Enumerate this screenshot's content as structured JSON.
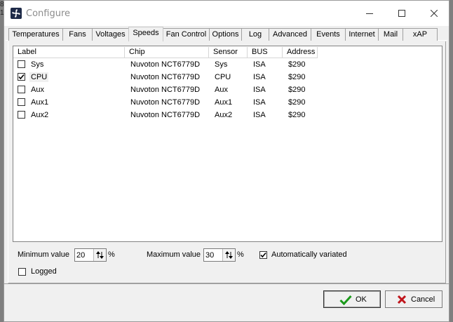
{
  "background_chars": [
    "8",
    "1"
  ],
  "window": {
    "title": "Configure",
    "icon": "fan-icon",
    "controls": [
      "minimize-icon",
      "maximize-icon",
      "close-icon"
    ]
  },
  "tabs": [
    {
      "label": "Temperatures",
      "active": false
    },
    {
      "label": "Fans",
      "active": false
    },
    {
      "label": "Voltages",
      "active": false
    },
    {
      "label": "Speeds",
      "active": true
    },
    {
      "label": "Fan Control",
      "active": false
    },
    {
      "label": "Options",
      "active": false
    },
    {
      "label": "Log",
      "active": false
    },
    {
      "label": "Advanced",
      "active": false
    },
    {
      "label": "Events",
      "active": false
    },
    {
      "label": "Internet",
      "active": false
    },
    {
      "label": "Mail",
      "active": false
    },
    {
      "label": "xAP",
      "active": false
    }
  ],
  "list": {
    "columns": [
      "Label",
      "Chip",
      "Sensor",
      "BUS",
      "Address"
    ],
    "rows": [
      {
        "checked": false,
        "label": "Sys",
        "chip": "Nuvoton NCT6779D",
        "sensor": "Sys",
        "bus": "ISA",
        "address": "$290"
      },
      {
        "checked": true,
        "label": "CPU",
        "chip": "Nuvoton NCT6779D",
        "sensor": "CPU",
        "bus": "ISA",
        "address": "$290"
      },
      {
        "checked": false,
        "label": "Aux",
        "chip": "Nuvoton NCT6779D",
        "sensor": "Aux",
        "bus": "ISA",
        "address": "$290"
      },
      {
        "checked": false,
        "label": "Aux1",
        "chip": "Nuvoton NCT6779D",
        "sensor": "Aux1",
        "bus": "ISA",
        "address": "$290"
      },
      {
        "checked": false,
        "label": "Aux2",
        "chip": "Nuvoton NCT6779D",
        "sensor": "Aux2",
        "bus": "ISA",
        "address": "$290"
      }
    ]
  },
  "settings": {
    "minimum_label": "Minimum value",
    "minimum_value": "20",
    "minimum_unit": "%",
    "maximum_label": "Maximum value",
    "maximum_value": "30",
    "maximum_unit": "%",
    "auto_varied_label": "Automatically variated",
    "auto_varied_checked": true,
    "logged_label": "Logged",
    "logged_checked": false
  },
  "buttons": {
    "ok_label": "OK",
    "cancel_label": "Cancel"
  },
  "colors": {
    "ok_check": "#1a9a1a",
    "cancel_x": "#c0141b"
  }
}
